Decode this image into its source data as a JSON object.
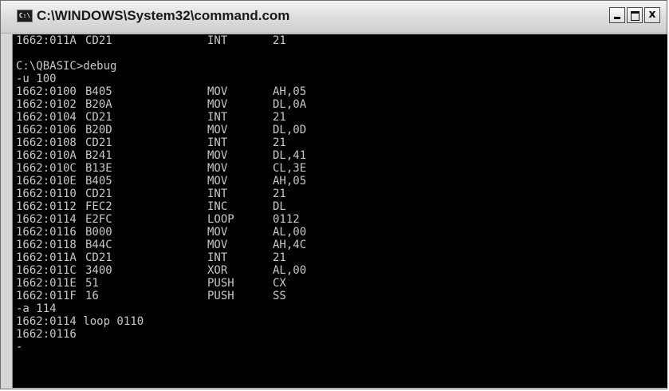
{
  "window": {
    "title": "C:\\WINDOWS\\System32\\command.com",
    "icon_glyph": "C:\\",
    "controls": {
      "minimize": "",
      "maximize": "",
      "close": "x"
    }
  },
  "console": {
    "top_line": {
      "addr": "1662:011A",
      "bytes": "CD21",
      "op": "INT",
      "arg": "21"
    },
    "prompt_line": "C:\\QBASIC>debug",
    "command_u": "-u 100",
    "disassembly": [
      {
        "addr": "1662:0100",
        "bytes": "B405",
        "op": "MOV",
        "arg": "AH,05"
      },
      {
        "addr": "1662:0102",
        "bytes": "B20A",
        "op": "MOV",
        "arg": "DL,0A"
      },
      {
        "addr": "1662:0104",
        "bytes": "CD21",
        "op": "INT",
        "arg": "21"
      },
      {
        "addr": "1662:0106",
        "bytes": "B20D",
        "op": "MOV",
        "arg": "DL,0D"
      },
      {
        "addr": "1662:0108",
        "bytes": "CD21",
        "op": "INT",
        "arg": "21"
      },
      {
        "addr": "1662:010A",
        "bytes": "B241",
        "op": "MOV",
        "arg": "DL,41"
      },
      {
        "addr": "1662:010C",
        "bytes": "B13E",
        "op": "MOV",
        "arg": "CL,3E"
      },
      {
        "addr": "1662:010E",
        "bytes": "B405",
        "op": "MOV",
        "arg": "AH,05"
      },
      {
        "addr": "1662:0110",
        "bytes": "CD21",
        "op": "INT",
        "arg": "21"
      },
      {
        "addr": "1662:0112",
        "bytes": "FEC2",
        "op": "INC",
        "arg": "DL"
      },
      {
        "addr": "1662:0114",
        "bytes": "E2FC",
        "op": "LOOP",
        "arg": "0112"
      },
      {
        "addr": "1662:0116",
        "bytes": "B000",
        "op": "MOV",
        "arg": "AL,00"
      },
      {
        "addr": "1662:0118",
        "bytes": "B44C",
        "op": "MOV",
        "arg": "AH,4C"
      },
      {
        "addr": "1662:011A",
        "bytes": "CD21",
        "op": "INT",
        "arg": "21"
      },
      {
        "addr": "1662:011C",
        "bytes": "3400",
        "op": "XOR",
        "arg": "AL,00"
      },
      {
        "addr": "1662:011E",
        "bytes": "51",
        "op": "PUSH",
        "arg": "CX"
      },
      {
        "addr": "1662:011F",
        "bytes": "16",
        "op": "PUSH",
        "arg": "SS"
      }
    ],
    "command_a": "-a 114",
    "assemble_line": "1662:0114 loop 0110",
    "assemble_next": "1662:0116",
    "cursor_line": "-"
  }
}
